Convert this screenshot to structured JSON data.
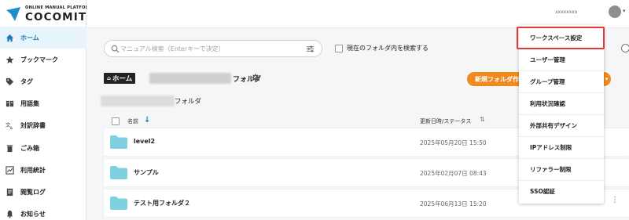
{
  "logo": {
    "subtitle": "ONLINE MANUAL PLATFORM",
    "name": "COCOMITE"
  },
  "sidebar": {
    "items": [
      {
        "label": "ホーム",
        "icon": "home-icon",
        "active": true
      },
      {
        "label": "ブックマーク",
        "icon": "star-icon"
      },
      {
        "label": "タグ",
        "icon": "tag-icon"
      },
      {
        "label": "用語集",
        "icon": "glossary-icon"
      },
      {
        "label": "対訳辞書",
        "icon": "translate-icon"
      },
      {
        "label": "ごみ箱",
        "icon": "trash-icon"
      },
      {
        "label": "利用統計",
        "icon": "chart-icon"
      },
      {
        "label": "閲覧ログ",
        "icon": "log-icon"
      },
      {
        "label": "お知らせ",
        "icon": "bell-icon"
      }
    ]
  },
  "header": {
    "username": "xxxxxxxx"
  },
  "search": {
    "placeholder": "マニュアル検索（Enterキーで決定）",
    "value": "",
    "current_folder_label": "現在のフォルダ内を検索する"
  },
  "breadcrumb": {
    "home_label": "ホーム",
    "folder_suffix": "フォルダ",
    "path_suffix": "フォルダ"
  },
  "actions": {
    "new_folder_label": "新規フォルダ作"
  },
  "table": {
    "col_name": "名前",
    "col_updated": "更新日時/ステータス",
    "rows": [
      {
        "name": "level2",
        "updated": "2025年05月20日 15:50"
      },
      {
        "name": "サンプル",
        "updated": "2025年02月07日 08:43"
      },
      {
        "name": "テスト用フォルダ２",
        "updated": "2025年06月13日 15:20"
      }
    ]
  },
  "menu": {
    "items": [
      {
        "label": "ワークスペース設定",
        "highlighted": true
      },
      {
        "label": "ユーザー管理"
      },
      {
        "label": "グループ管理"
      },
      {
        "label": "利用状況確認"
      },
      {
        "label": "外部共有デザイン"
      },
      {
        "label": "IPアドレス制限"
      },
      {
        "label": "リファラー制限"
      },
      {
        "label": "SSO認証"
      }
    ]
  },
  "colors": {
    "accent_blue": "#1a7ab8",
    "active_bg": "#e7f4fb",
    "orange": "#f08a1f",
    "folder": "#7fd0e0",
    "highlight_red": "#e53935"
  }
}
